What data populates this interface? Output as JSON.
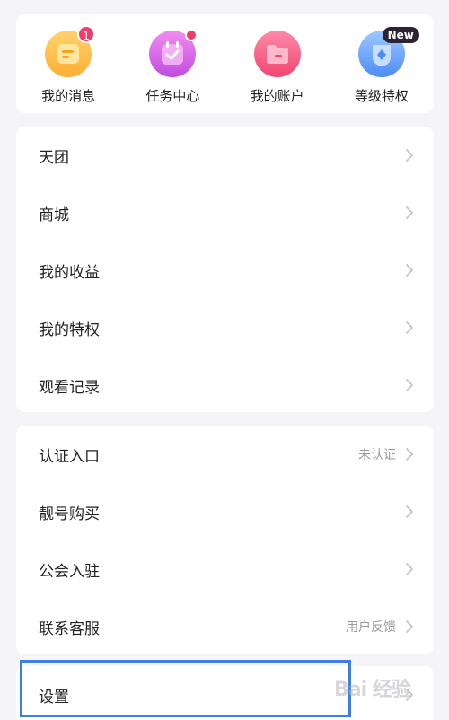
{
  "shortcuts": [
    {
      "label": "我的消息",
      "badge": "1",
      "icon": "message-icon",
      "color_top": "#ffd36b",
      "color_bottom": "#ffae34"
    },
    {
      "label": "任务中心",
      "icon": "calendar-check-icon",
      "color_top": "#f18cf0",
      "color_bottom": "#c04ce0"
    },
    {
      "label": "我的账户",
      "icon": "folder-icon",
      "color_top": "#ff8aa8",
      "color_bottom": "#f0466f"
    },
    {
      "label": "等级特权",
      "badge": "New",
      "icon": "diamond-icon",
      "color_top": "#9ec9ff",
      "color_bottom": "#4d8cf5"
    }
  ],
  "menu_group_1": [
    {
      "label": "天团"
    },
    {
      "label": "商城"
    },
    {
      "label": "我的收益"
    },
    {
      "label": "我的特权"
    },
    {
      "label": "观看记录"
    }
  ],
  "menu_group_2": [
    {
      "label": "认证入口",
      "value": "未认证"
    },
    {
      "label": "靓号购买",
      "value": ""
    },
    {
      "label": "公会入驻",
      "value": ""
    },
    {
      "label": "联系客服",
      "value": "用户反馈"
    }
  ],
  "menu_group_3": [
    {
      "label": "设置"
    }
  ],
  "highlight_color": "#3e7ee3",
  "watermark": "Bai 经验"
}
